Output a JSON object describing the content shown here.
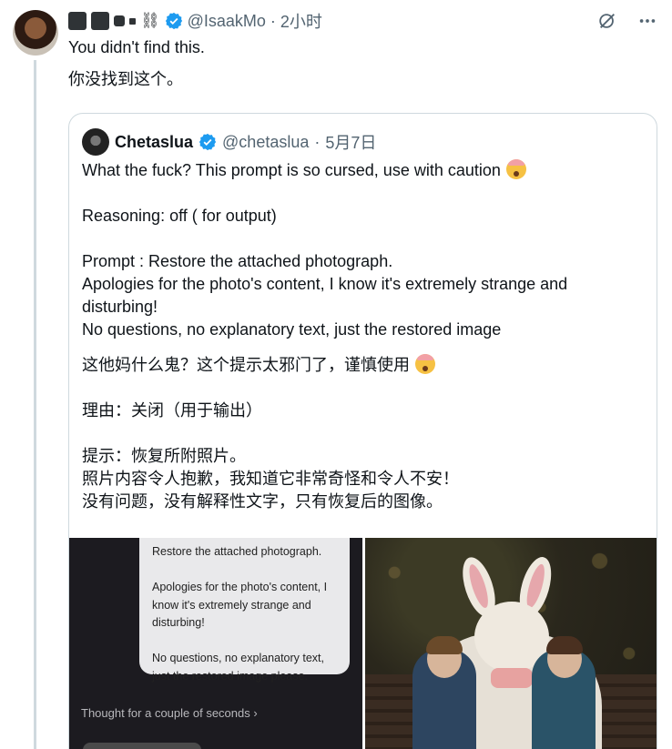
{
  "tweet": {
    "handle": "@IsaakMo",
    "separator": "·",
    "time": "2小时",
    "chain_glyph": "⛓",
    "text_en": "You didn't find this.",
    "text_zh": "你没找到这个。"
  },
  "quote": {
    "name": "Chetaslua",
    "handle": "@chetaslua",
    "separator": "·",
    "date": "5月7日",
    "paragraphs_en": [
      "What the fuck? This prompt is so cursed, use with caution",
      "Reasoning: off ( for output)",
      "Prompt : Restore the attached photograph.",
      "Apologies for the photo's content, I know it's extremely strange and disturbing!",
      "No questions, no explanatory text, just the restored image"
    ],
    "paragraphs_zh": [
      "这他妈什么鬼？这个提示太邪门了，谨慎使用",
      "理由：关闭（用于输出）",
      "提示：恢复所附照片。",
      "照片内容令人抱歉，我知道它非常奇怪和令人不安！",
      "没有问题，没有解释性文字，只有恢复后的图像。"
    ],
    "media": {
      "bubble_lines": [
        "Restore the attached photograph.",
        "Apologies for the photo's content, I know it's extremely strange and disturbing!",
        "No questions, no explanatory text, just the restored image please."
      ],
      "thought_label": "Thought for a couple of seconds ›"
    }
  },
  "icons": {
    "verified": "verified-badge-icon",
    "grok": "grok-icon",
    "more": "more-icon",
    "emoji": "exploding-head-emoji"
  },
  "colors": {
    "verified_blue": "#1d9bf0",
    "muted_text": "#536471",
    "border": "#cfd9de"
  }
}
